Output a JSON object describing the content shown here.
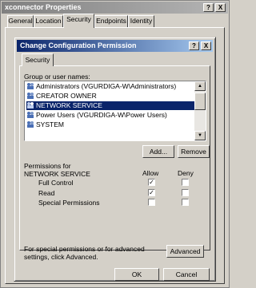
{
  "outer": {
    "title": "xconnector Properties",
    "help_btn": "?",
    "close_btn": "X",
    "tabs": [
      "General",
      "Location",
      "Security",
      "Endpoints",
      "Identity"
    ]
  },
  "dialog": {
    "title": "Change Configuration Permission",
    "help_btn": "?",
    "close_btn": "X",
    "tab": "Security",
    "group_label": "Group or user names:",
    "users": [
      "Administrators (VGURDIGA-W\\Administrators)",
      "CREATOR OWNER",
      "NETWORK SERVICE",
      "Power Users (VGURDIGA-W\\Power Users)",
      "SYSTEM"
    ],
    "selected_user_index": 2,
    "add_btn": "Add...",
    "remove_btn": "Remove",
    "permissions_for": "Permissions for NETWORK SERVICE",
    "col_allow": "Allow",
    "col_deny": "Deny",
    "permissions": [
      {
        "name": "Full Control",
        "allow": true,
        "deny": false
      },
      {
        "name": "Read",
        "allow": true,
        "deny": false
      },
      {
        "name": "Special Permissions",
        "allow": false,
        "deny": false
      }
    ],
    "advanced_text": "For special permissions or for advanced settings, click Advanced.",
    "advanced_btn": "Advanced",
    "ok_btn": "OK",
    "cancel_btn": "Cancel"
  }
}
